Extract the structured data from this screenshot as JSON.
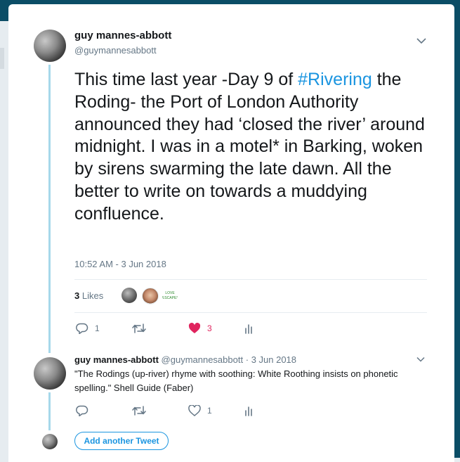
{
  "tweet": {
    "author_name": "guy mannes-abbott",
    "author_handle": "@guymannesabbott",
    "text_before_hashtag": "This time last year -Day 9 of ",
    "hashtag": "#Rivering",
    "text_after_hashtag": " the Roding- the Port of London Authority announced they had ‘closed the river’ around midnight. I was in a motel* in Barking, woken by sirens swarming the late dawn. All the better to write on towards a muddying confluence.",
    "timestamp": "10:52 AM - 3 Jun 2018",
    "likes_count": "3",
    "likes_label": "Likes",
    "liker_badge_text": "LOVE ESCAPES",
    "reply_count": "1",
    "retweet_count": "",
    "like_count": "3"
  },
  "reply": {
    "author_name": "guy mannes-abbott",
    "author_handle": "@guymannesabbott",
    "date_separator": "·",
    "date": "3 Jun 2018",
    "text": "\"The Rodings (up-river) rhyme with soothing: White Roothing insists on phonetic spelling.\" Shell Guide (Faber)",
    "reply_count": "",
    "retweet_count": "",
    "like_count": "1"
  },
  "composer": {
    "add_button_label": "Add another Tweet"
  },
  "colors": {
    "accent": "#1b95e0",
    "like_active": "#e0245e",
    "thread_line": "#a6d8ea",
    "secondary_text": "#657786",
    "backdrop": "#0b4d66"
  },
  "icons": {
    "reply": "reply-icon",
    "retweet": "retweet-icon",
    "like_filled": "heart-filled-icon",
    "like_outline": "heart-outline-icon",
    "analytics": "analytics-icon",
    "menu": "chevron-down-icon"
  }
}
